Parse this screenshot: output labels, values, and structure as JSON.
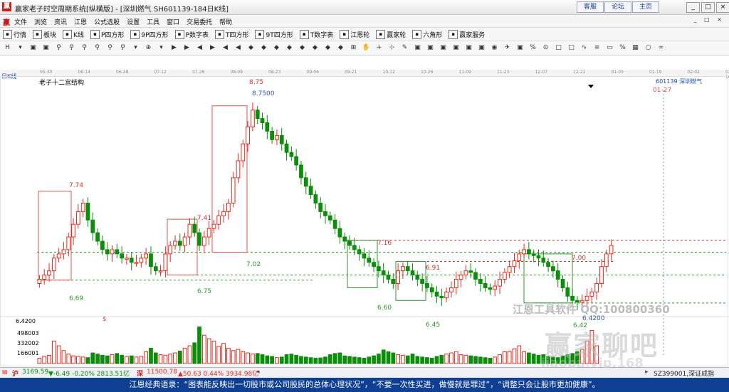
{
  "window": {
    "title": "赢家老子时空周期系统[纵横版] - [深圳燃气 SH601139-184日K线]",
    "top_links": [
      "客服",
      "论坛",
      "主页"
    ],
    "controls": [
      "_",
      "□",
      "×"
    ]
  },
  "menu": {
    "items": [
      "文件",
      "浏览",
      "资讯",
      "江恩",
      "公式选股",
      "设置",
      "工具",
      "窗口",
      "交易委托",
      "帮助"
    ],
    "mdi_controls": "_ □ ×"
  },
  "toolbar": {
    "items": [
      {
        "icon": "table-icon",
        "label": "行情"
      },
      {
        "icon": "grid-icon",
        "label": "板块"
      },
      {
        "icon": "candlestick-icon",
        "label": "K线"
      },
      {
        "icon": "square-icon",
        "label": "P四方形"
      },
      {
        "icon": "square-icon",
        "label": "9P四方形"
      },
      {
        "icon": "square-icon",
        "label": "P数字表"
      },
      {
        "icon": "square-icon",
        "label": "T四方形"
      },
      {
        "icon": "square-icon",
        "label": "9T四方形"
      },
      {
        "icon": "square-icon",
        "label": "T数字表"
      },
      {
        "icon": "wheel-icon",
        "label": "江恩轮"
      },
      {
        "icon": "wheel-icon",
        "label": "赢家轮"
      },
      {
        "icon": "hexagon-icon",
        "label": "六角形"
      },
      {
        "icon": "dollar-icon",
        "label": "赢家服务"
      }
    ]
  },
  "toolbar2_icons": [
    "H",
    "▾",
    "▣",
    "▣",
    "⚲",
    "⚲",
    "⚲",
    "⚲",
    "⚲",
    "⚲",
    "▾",
    "⊕",
    "▾",
    "▶",
    "▶",
    "◀",
    "▶",
    "◀",
    "◀",
    "◆",
    "◆",
    "◆",
    "◆",
    "◆",
    "◆",
    "◆",
    "◆",
    "⊞",
    "✋",
    "+",
    "⊹",
    "✎",
    "▣",
    "▣",
    "▣",
    "▣",
    "▣",
    "▣",
    "◉",
    "✈",
    "▣",
    "%",
    "⊙",
    "□",
    "□",
    "∿",
    "≡",
    "▭",
    "%",
    "▦",
    "○",
    "∞"
  ],
  "date_axis": [
    "05-30",
    "06-14",
    "06-28",
    "07-12",
    "07-26",
    "08-09",
    "08-23",
    "09-06",
    "09-21",
    "10-12",
    "10-26",
    "11-09",
    "11-23",
    "12-07",
    "12-21",
    "01-05",
    "01-19",
    "02-02",
    "02-16"
  ],
  "chart": {
    "side_label": "日K线",
    "name": "老子十二宫结构",
    "stock": "601139  深圳燃气",
    "future_date": "01-27",
    "price_labels": [
      "8.75",
      "8.7500",
      "7.74",
      "7.41",
      "7.02",
      "6.69",
      "6.75",
      "7.16",
      "6.91",
      "7.00",
      "6.60",
      "6.45",
      "6.42",
      "6.4200"
    ],
    "left_price": "6.4200",
    "volume_ticks": [
      "498003",
      "332002",
      "166001"
    ],
    "dollar_mark": "$",
    "watermark_text": "江恩工具软件  QQ:100800360",
    "watermark_brand": "赢家聊吧",
    "watermark_url": "jiaoba.vip.168"
  },
  "chart_data": {
    "type": "candlestick",
    "title": "老子十二宫结构",
    "series_name": "601139 深圳燃气",
    "x_range": [
      "05-30",
      "02-16"
    ],
    "y_range": [
      6.2,
      9.0
    ],
    "key_levels": [
      8.75,
      7.74,
      7.41,
      7.16,
      7.02,
      7.0,
      6.91,
      6.75,
      6.69,
      6.6,
      6.45,
      6.42
    ],
    "close_path": [
      6.7,
      6.75,
      6.8,
      6.95,
      7.0,
      7.05,
      7.2,
      7.35,
      7.5,
      7.6,
      7.4,
      7.25,
      7.15,
      7.05,
      7.0,
      7.05,
      7.0,
      6.95,
      6.95,
      6.9,
      6.9,
      6.95,
      7.0,
      6.85,
      6.8,
      6.8,
      7.0,
      7.1,
      7.15,
      7.1,
      7.2,
      7.35,
      7.25,
      7.1,
      7.2,
      7.3,
      7.35,
      7.45,
      7.5,
      7.6,
      7.9,
      8.1,
      8.3,
      8.5,
      8.7,
      8.6,
      8.55,
      8.45,
      8.35,
      8.4,
      8.3,
      8.2,
      8.15,
      8.05,
      7.9,
      7.8,
      7.7,
      7.6,
      7.5,
      7.45,
      7.4,
      7.3,
      7.2,
      7.15,
      7.1,
      7.05,
      7.0,
      6.95,
      6.9,
      6.85,
      6.8,
      6.75,
      6.7,
      6.65,
      6.8,
      6.85,
      6.8,
      6.75,
      6.7,
      6.65,
      6.6,
      6.55,
      6.5,
      6.48,
      6.55,
      6.6,
      6.7,
      6.75,
      6.8,
      6.78,
      6.7,
      6.65,
      6.6,
      6.58,
      6.62,
      6.7,
      6.78,
      6.85,
      6.92,
      7.0,
      7.05,
      7.0,
      6.98,
      6.95,
      6.9,
      6.85,
      6.8,
      6.7,
      6.6,
      6.5,
      6.45,
      6.43,
      6.45,
      6.5,
      6.55,
      6.65,
      6.85,
      7.0,
      7.1
    ],
    "volume_path": [
      90,
      120,
      140,
      380,
      300,
      220,
      160,
      130,
      120,
      110,
      100,
      180,
      160,
      140,
      130,
      150,
      170,
      140,
      120,
      130,
      110,
      120,
      200,
      260,
      180,
      150,
      140,
      160,
      180,
      210,
      260,
      300,
      350,
      620,
      480,
      420,
      380,
      290,
      340,
      260,
      220,
      240,
      200,
      180,
      160,
      170,
      150,
      130,
      120,
      100,
      110,
      150,
      160,
      140,
      120,
      110,
      100,
      90,
      95,
      110,
      150,
      170,
      180,
      130,
      120,
      110,
      100,
      90,
      110,
      130,
      160,
      230,
      200,
      180,
      150,
      140,
      130,
      160,
      120,
      110,
      100,
      90,
      120,
      140,
      160,
      180,
      200,
      150,
      140,
      130,
      120,
      110,
      100,
      90,
      110,
      150,
      200,
      210,
      250,
      300,
      200,
      180,
      160,
      140,
      150,
      120,
      110,
      100,
      130,
      150,
      170,
      200,
      240,
      380,
      560,
      300
    ]
  },
  "status": {
    "sh_index": "3169.59",
    "sh_change": "▼-6.49 -0.20% 2813.51亿",
    "sz_index": "11500.78",
    "sz_change": "▲50.63 0.44% 3934.98亿",
    "right_code": "SZ399001,深证成指"
  },
  "quote": "江恩经典语录：“图表能反映出一切股市或公司股民的总体心理状况”，“不要一次性买进，做慢就是罪过”，“调整只会让股市更加健康”。",
  "colors": {
    "up": "#e8281c",
    "down": "#0a8f0a",
    "box_red": "#e05050",
    "box_green": "#2a9a2a",
    "level_red": "#cc3333",
    "level_green": "#2a9a2a",
    "title_blue": "#0f3f92"
  }
}
